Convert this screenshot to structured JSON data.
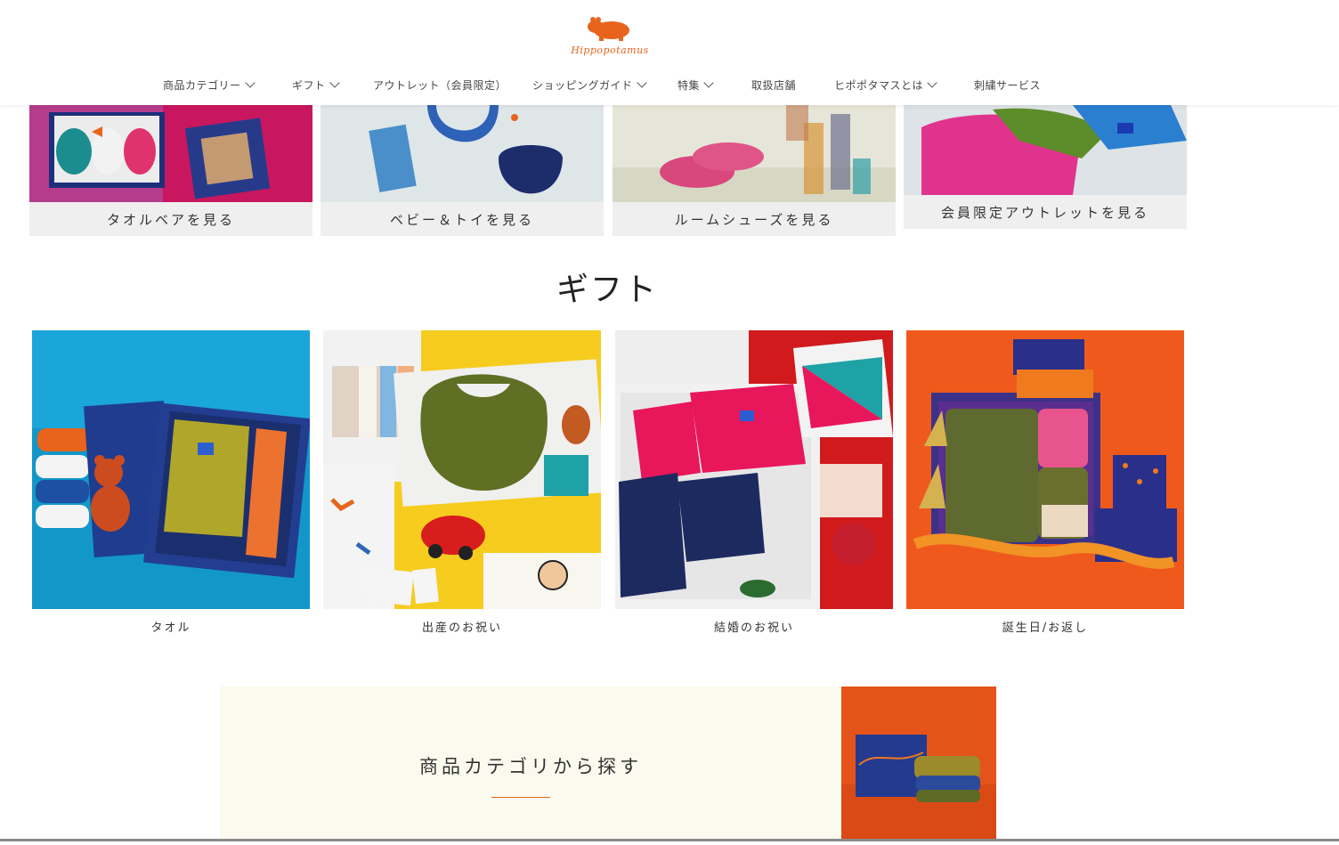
{
  "brand": {
    "logo_text": "Hippopotamus",
    "accent_color": "#e8641c"
  },
  "nav": [
    {
      "label": "商品カテゴリー",
      "dropdown": true
    },
    {
      "label": "ギフト",
      "dropdown": true
    },
    {
      "label": "アウトレット（会員限定）",
      "dropdown": false
    },
    {
      "label": "ショッピングガイド",
      "dropdown": true
    },
    {
      "label": "特集",
      "dropdown": true
    },
    {
      "label": "取扱店舗",
      "dropdown": false
    },
    {
      "label": "ヒポポタマスとは",
      "dropdown": true
    },
    {
      "label": "刺繍サービス",
      "dropdown": false
    }
  ],
  "categories": [
    {
      "label": "タオルベアを見る"
    },
    {
      "label": "ベビー＆トイを見る"
    },
    {
      "label": "ルームシューズを見る"
    },
    {
      "label": "会員限定アウトレットを見る"
    }
  ],
  "gift": {
    "title": "ギフト",
    "items": [
      {
        "label": "タオル"
      },
      {
        "label": "出産のお祝い"
      },
      {
        "label": "結婚のお祝い"
      },
      {
        "label": "誕生日/お返し"
      }
    ]
  },
  "category_banner": {
    "title": "商品カテゴリから探す"
  }
}
